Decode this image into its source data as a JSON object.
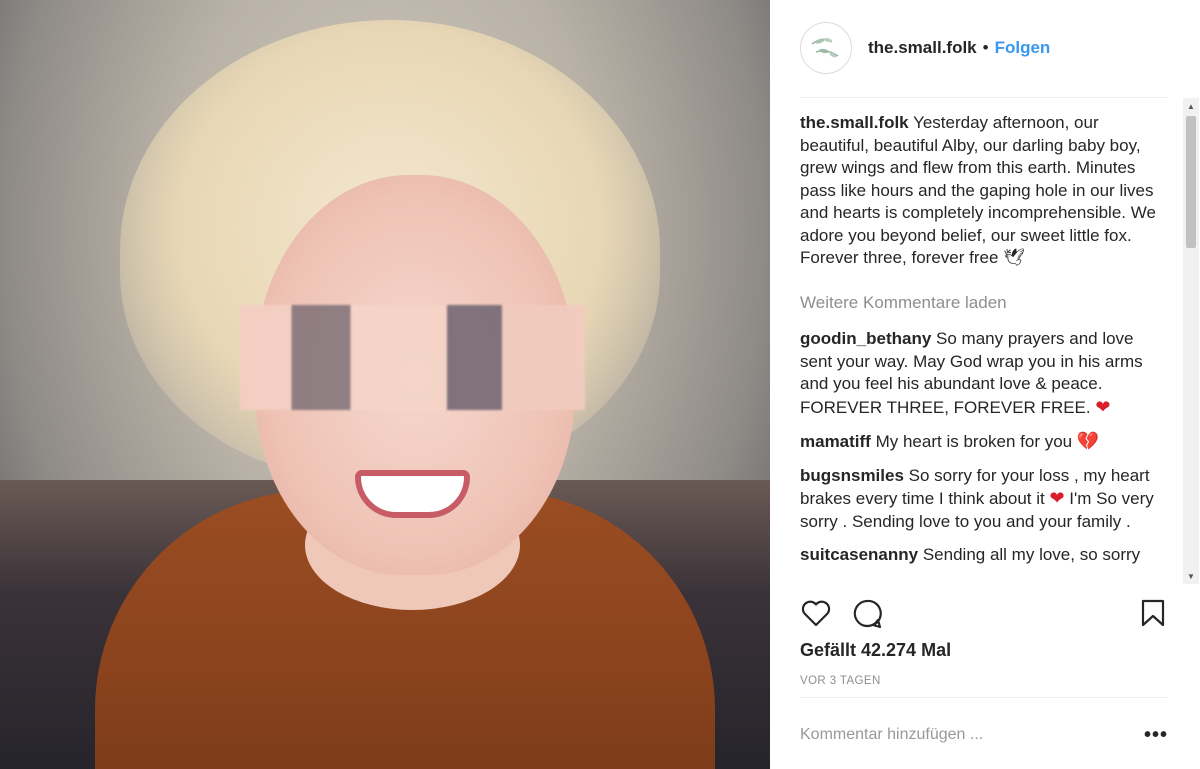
{
  "post": {
    "username": "the.small.folk",
    "separator": "•",
    "follow_label": "Folgen",
    "caption_user": "the.small.folk",
    "caption_text": "Yesterday afternoon, our beautiful, beautiful Alby, our darling baby boy, grew wings and flew from this earth. Minutes pass like hours and the gaping hole in our lives and hearts is completely incomprehensible. We adore you beyond belief, our sweet little fox. Forever three, forever free 🕊",
    "load_more_label": "Weitere Kommentare laden"
  },
  "comments": [
    {
      "user": "goodin_bethany",
      "text": "So many prayers and love sent your way. May God wrap you in his arms and you feel his abundant love & peace. FOREVER THREE, FOREVER FREE.",
      "emoji": "❤"
    },
    {
      "user": "mamatiff",
      "text": "My heart is broken for you",
      "emoji": "💔"
    },
    {
      "user": "bugsnsmiles",
      "text": "So sorry for your loss , my heart brakes every time I think about it",
      "emoji": "❤",
      "text2": "I'm So very sorry . Sending love to you and your family ."
    },
    {
      "user": "suitcasenanny",
      "text": "Sending all my love, so sorry"
    }
  ],
  "actions": {
    "like_icon": "heart-outline-icon",
    "comment_icon": "comment-bubble-icon",
    "save_icon": "bookmark-icon"
  },
  "likes_text": "Gefällt 42.274 Mal",
  "time_text": "VOR 3 TAGEN",
  "add_comment": {
    "placeholder": "Kommentar hinzufügen ...",
    "more_label": "•••"
  },
  "colors": {
    "link_blue": "#3897f0",
    "text": "#262626",
    "muted": "#8e8e8e",
    "heart_red": "#d91d2b"
  }
}
